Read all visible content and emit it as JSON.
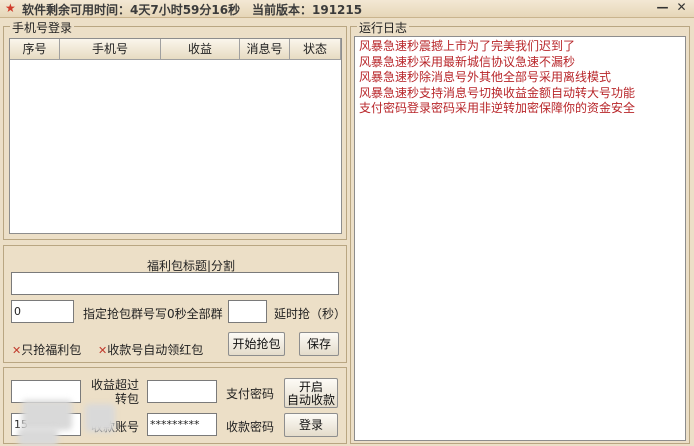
{
  "title": {
    "remaining_label": "软件剩余可用时间：4天7小时59分16秒",
    "version_label": "当前版本：191215"
  },
  "window_buttons": {
    "minimize": "—",
    "close": "✕"
  },
  "phone_login": {
    "title": "手机号登录",
    "columns": [
      "序号",
      "手机号",
      "收益",
      "消息号",
      "状态"
    ]
  },
  "log": {
    "title": "运行日志",
    "lines": [
      "风暴急速秒震撼上市为了完美我们迟到了",
      "风暴急速秒采用最新城信协议急速不漏秒",
      "风暴急速秒除消息号外其他全部号采用离线模式",
      "风暴急速秒支持消息号切换收益金额自动转大号功能",
      "支付密码登录密码采用非逆转加密保障你的资金安全"
    ]
  },
  "welfare": {
    "title": "福利包标题|分割",
    "title_value": "",
    "group_value": "0",
    "group_label": "指定抢包群号写0秒全部群",
    "delay_value": "",
    "delay_label": "延时抢（秒）",
    "only_welfare_label": "只抢福利包",
    "auto_red_label": "收款号自动领红包",
    "start_button": "开始抢包",
    "save_button": "保存"
  },
  "account": {
    "income_value": "",
    "income_label_line1": "收益超过",
    "income_label_line2": "转包",
    "pay_password_value": "",
    "pay_password_label": "支付密码",
    "auto_collect_line1": "开启",
    "auto_collect_line2": "自动收款",
    "account_value": "15",
    "account_label": "收款账号",
    "collect_password_value": "*********",
    "collect_password_label": "收款密码",
    "login_button": "登录"
  }
}
